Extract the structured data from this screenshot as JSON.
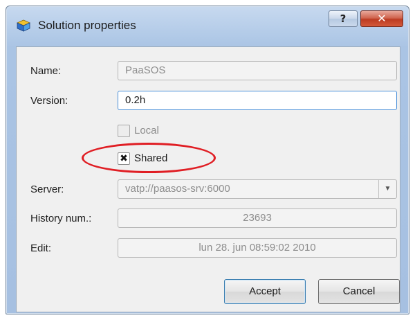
{
  "window": {
    "title": "Solution properties",
    "help_label": "?",
    "close_label": "✕"
  },
  "form": {
    "name_label": "Name:",
    "name_value": "PaaSOS",
    "version_label": "Version:",
    "version_value": "0.2h",
    "local_label": "Local",
    "local_checked": false,
    "shared_label": "Shared",
    "shared_checked": true,
    "shared_mark": "✖",
    "server_label": "Server:",
    "server_value": "vatp://paasos-srv:6000",
    "history_label": "History num.:",
    "history_value": "23693",
    "edit_label": "Edit:",
    "edit_value": "lun 28. jun 08:59:02 2010"
  },
  "buttons": {
    "accept_label": "Accept",
    "cancel_label": "Cancel"
  },
  "colors": {
    "highlight_ellipse": "#e01e24",
    "focus_border": "#4a8fd8"
  }
}
